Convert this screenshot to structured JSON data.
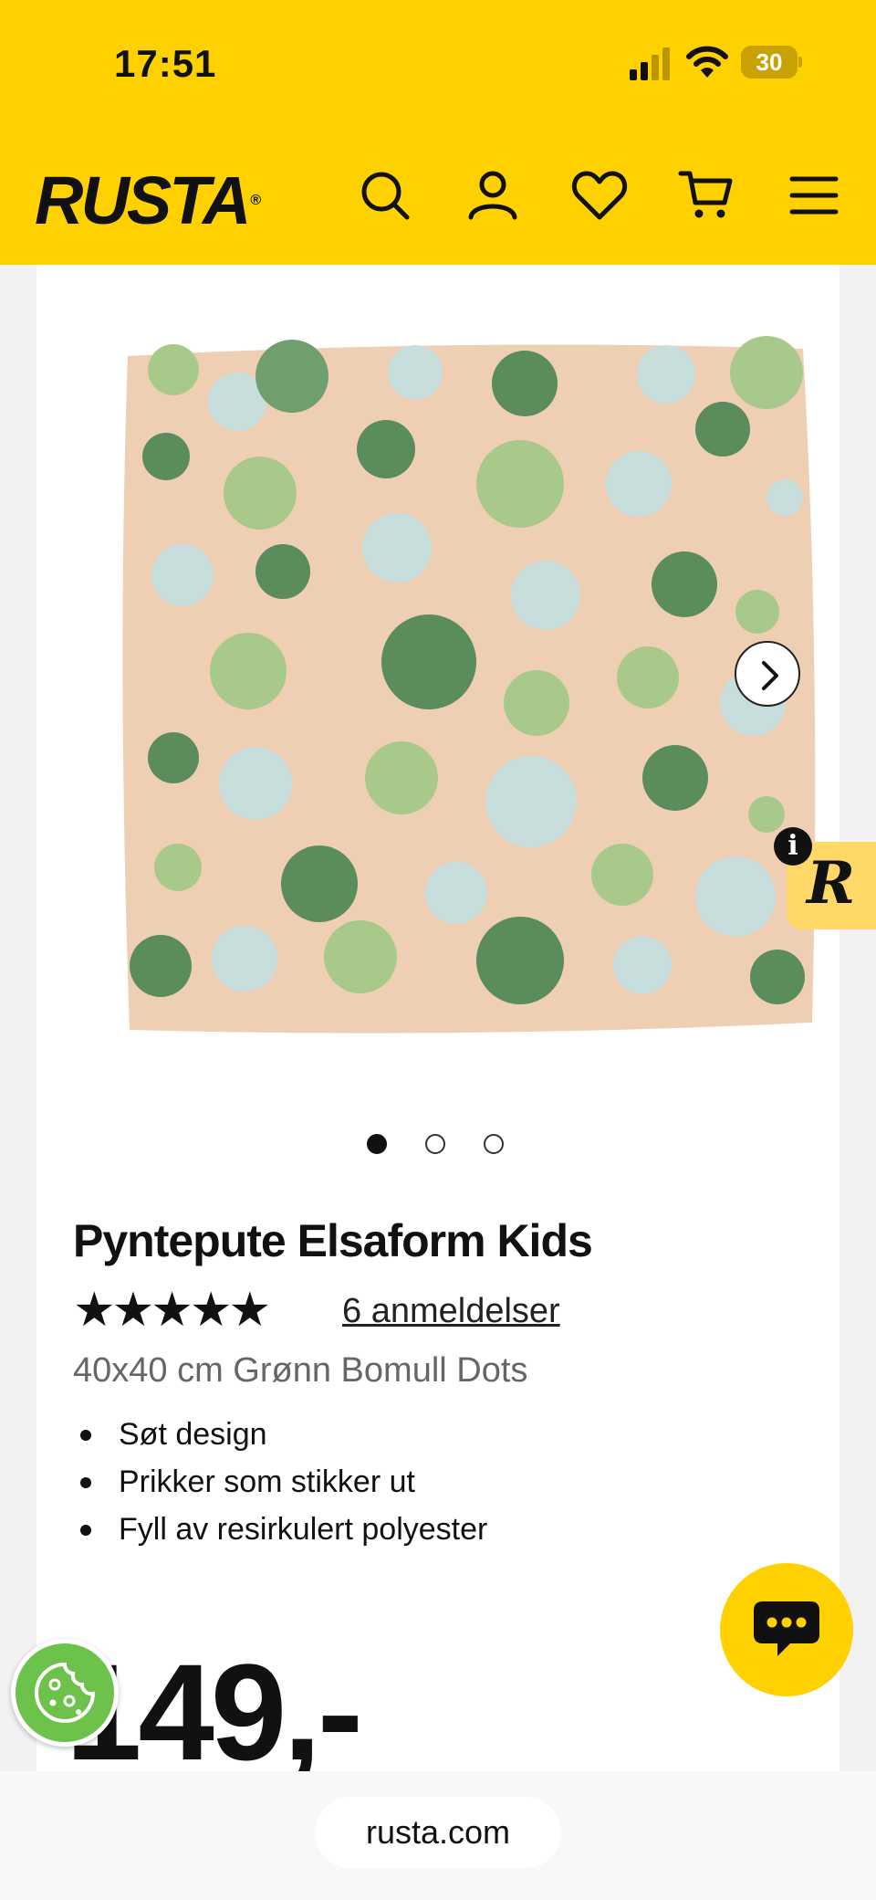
{
  "status_bar": {
    "time": "17:51",
    "battery": "30"
  },
  "header": {
    "logo": "RUSTA",
    "logo_mark": "®",
    "icons": [
      "search-icon",
      "account-icon",
      "heart-icon",
      "cart-icon",
      "menu-icon"
    ]
  },
  "product": {
    "title": "Pyntepute Elsaform Kids",
    "stars": "★★★★★",
    "rating": 5,
    "reviews": "6 anmeldelser",
    "subtitle": "40x40 cm Grønn Bomull Dots",
    "bullets": [
      "Søt design",
      "Prikker som stikker ut",
      "Fyll av resirkulert polyester"
    ],
    "price": "149,-",
    "carousel": {
      "count": 3,
      "active": 1
    }
  },
  "badges": {
    "info": "i",
    "r_logo": "R"
  },
  "browser": {
    "url": "rusta.com"
  },
  "colors": {
    "brand_yellow": "#ffd100",
    "text": "#111111",
    "muted": "#666666",
    "cookie_green": "#6cc24a"
  }
}
